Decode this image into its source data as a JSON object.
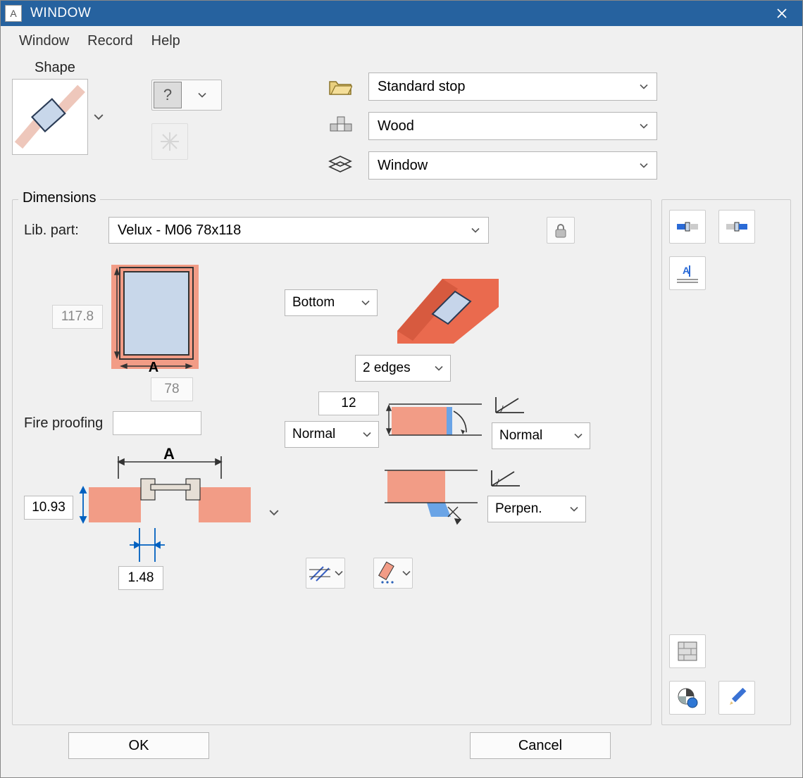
{
  "title": "WINDOW",
  "menu": {
    "window": "Window",
    "record": "Record",
    "help": "Help"
  },
  "shape_label": "Shape",
  "stop_value": "Standard stop",
  "material_value": "Wood",
  "layer_value": "Window",
  "dim": {
    "legend": "Dimensions",
    "lib_label": "Lib. part:",
    "lib_value": "Velux - M06 78x118",
    "height": "117.8",
    "width": "78",
    "fire_label": "Fire proofing",
    "fire_value": "",
    "cut_depth": "10.93",
    "offset": "1.48",
    "A": "A",
    "ref_value": "Bottom",
    "edges_value": "2 edges",
    "edge_dim": "12",
    "edge_mode1": "Normal",
    "edge_mode2": "Normal",
    "edge_mode3": "Perpen."
  },
  "footer": {
    "ok": "OK",
    "cancel": "Cancel"
  }
}
